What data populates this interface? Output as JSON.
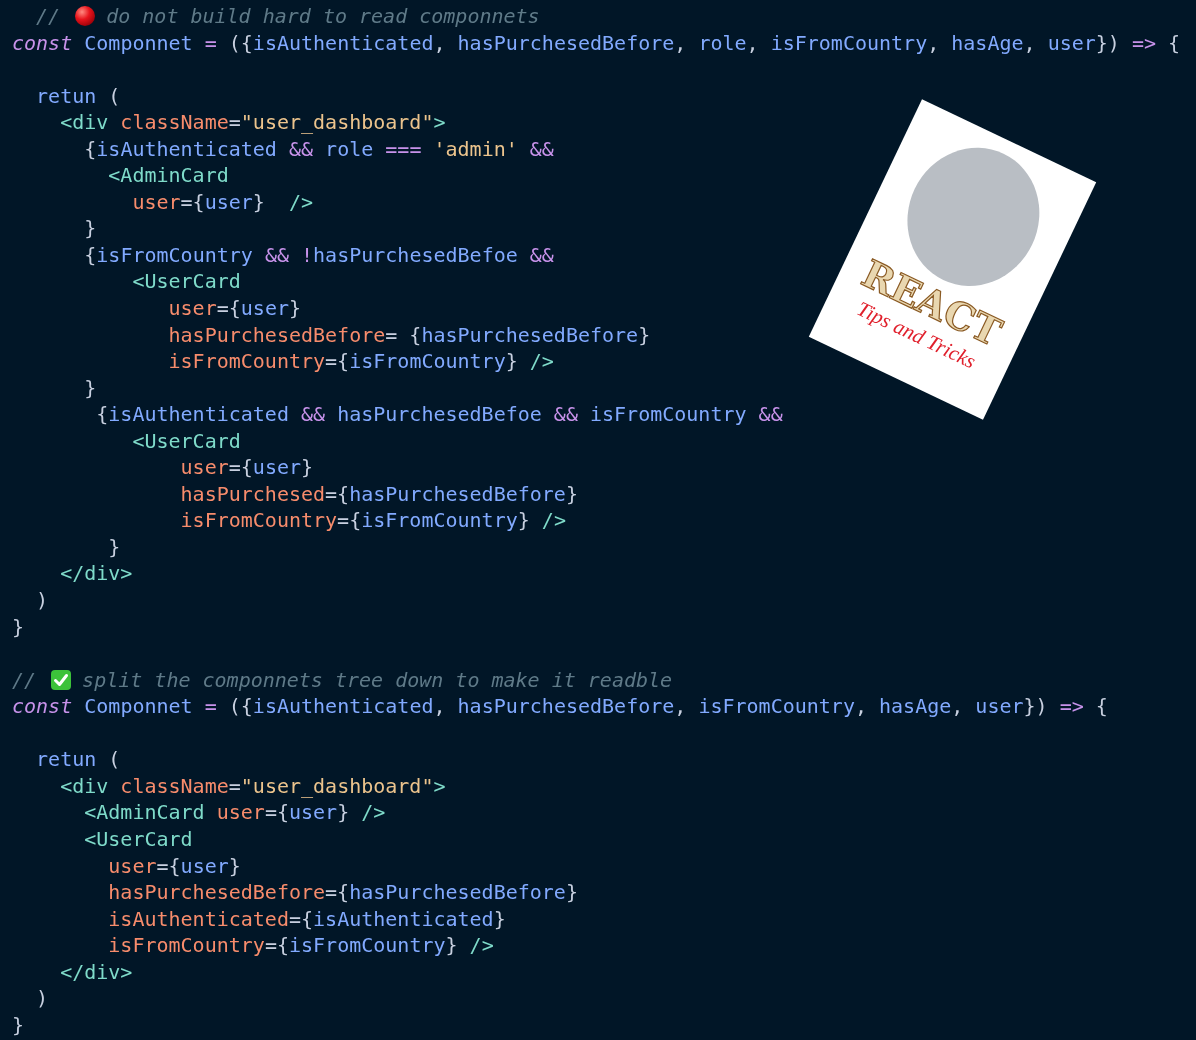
{
  "editor": {
    "lines": [
      {
        "kind": "warning_comment",
        "prefix": "  //",
        "text": "do not build hard to read componnets"
      },
      {
        "kind": "code",
        "tokens": [
          {
            "kind": "keyword",
            "text": "const"
          },
          {
            "kind": "variable",
            "text": " Componnet"
          },
          {
            "kind": "operator",
            "text": " = "
          },
          {
            "kind": "punct",
            "text": "({"
          },
          {
            "kind": "variable",
            "text": "isAuthenticated"
          },
          {
            "kind": "punct",
            "text": ","
          },
          {
            "kind": "variable",
            "text": " hasPurchesedBefore"
          },
          {
            "kind": "punct",
            "text": ","
          },
          {
            "kind": "variable",
            "text": " role"
          },
          {
            "kind": "punct",
            "text": ","
          },
          {
            "kind": "variable",
            "text": " isFromCountry"
          },
          {
            "kind": "punct",
            "text": ","
          },
          {
            "kind": "variable",
            "text": " hasAge"
          },
          {
            "kind": "punct",
            "text": ","
          },
          {
            "kind": "variable",
            "text": " user"
          },
          {
            "kind": "punct",
            "text": "})"
          },
          {
            "kind": "operator",
            "text": " => "
          },
          {
            "kind": "punct",
            "text": "{"
          }
        ]
      },
      {
        "kind": "blank"
      },
      {
        "kind": "code",
        "tokens": [
          {
            "kind": "variable",
            "text": "  retun"
          },
          {
            "kind": "punct",
            "text": " ("
          }
        ]
      },
      {
        "kind": "code",
        "tokens": [
          {
            "kind": "tag",
            "text": "    <div"
          },
          {
            "kind": "attr",
            "text": " className"
          },
          {
            "kind": "punct",
            "text": "="
          },
          {
            "kind": "string",
            "text": "\"user_dashboard\""
          },
          {
            "kind": "tag",
            "text": ">"
          }
        ]
      },
      {
        "kind": "code",
        "tokens": [
          {
            "kind": "punct",
            "text": "      {"
          },
          {
            "kind": "variable",
            "text": "isAuthenticated"
          },
          {
            "kind": "operator",
            "text": " && "
          },
          {
            "kind": "variable",
            "text": "role"
          },
          {
            "kind": "operator",
            "text": " === "
          },
          {
            "kind": "string",
            "text": "'admin'"
          },
          {
            "kind": "operator",
            "text": " &&"
          }
        ]
      },
      {
        "kind": "code",
        "tokens": [
          {
            "kind": "tag",
            "text": "        <AdminCard"
          }
        ]
      },
      {
        "kind": "code",
        "tokens": [
          {
            "kind": "attr",
            "text": "          user"
          },
          {
            "kind": "punct",
            "text": "={"
          },
          {
            "kind": "variable",
            "text": "user"
          },
          {
            "kind": "punct",
            "text": "}"
          },
          {
            "kind": "tag",
            "text": "  />"
          }
        ]
      },
      {
        "kind": "code",
        "tokens": [
          {
            "kind": "punct",
            "text": "      }"
          }
        ]
      },
      {
        "kind": "code",
        "tokens": [
          {
            "kind": "punct",
            "text": "      {"
          },
          {
            "kind": "variable",
            "text": "isFromCountry"
          },
          {
            "kind": "operator",
            "text": " && !"
          },
          {
            "kind": "variable",
            "text": "hasPurchesedBefoe"
          },
          {
            "kind": "operator",
            "text": " &&"
          }
        ]
      },
      {
        "kind": "code",
        "tokens": [
          {
            "kind": "tag",
            "text": "          <UserCard"
          }
        ]
      },
      {
        "kind": "code",
        "tokens": [
          {
            "kind": "attr",
            "text": "             user"
          },
          {
            "kind": "punct",
            "text": "={"
          },
          {
            "kind": "variable",
            "text": "user"
          },
          {
            "kind": "punct",
            "text": "}"
          }
        ]
      },
      {
        "kind": "code",
        "tokens": [
          {
            "kind": "attr",
            "text": "             hasPurchesedBefore"
          },
          {
            "kind": "punct",
            "text": "= {"
          },
          {
            "kind": "variable",
            "text": "hasPurchesedBefore"
          },
          {
            "kind": "punct",
            "text": "}"
          }
        ]
      },
      {
        "kind": "code",
        "tokens": [
          {
            "kind": "attr",
            "text": "             isFromCountry"
          },
          {
            "kind": "punct",
            "text": "={"
          },
          {
            "kind": "variable",
            "text": "isFromCountry"
          },
          {
            "kind": "punct",
            "text": "}"
          },
          {
            "kind": "tag",
            "text": " />"
          }
        ]
      },
      {
        "kind": "code",
        "tokens": [
          {
            "kind": "punct",
            "text": "      }"
          }
        ]
      },
      {
        "kind": "code",
        "tokens": [
          {
            "kind": "punct",
            "text": "       {"
          },
          {
            "kind": "variable",
            "text": "isAuthenticated"
          },
          {
            "kind": "operator",
            "text": " && "
          },
          {
            "kind": "variable",
            "text": "hasPurchesedBefoe"
          },
          {
            "kind": "operator",
            "text": " && "
          },
          {
            "kind": "variable",
            "text": "isFromCountry"
          },
          {
            "kind": "operator",
            "text": " &&"
          }
        ]
      },
      {
        "kind": "code",
        "tokens": [
          {
            "kind": "tag",
            "text": "          <UserCard"
          }
        ]
      },
      {
        "kind": "code",
        "tokens": [
          {
            "kind": "attr",
            "text": "              user"
          },
          {
            "kind": "punct",
            "text": "={"
          },
          {
            "kind": "variable",
            "text": "user"
          },
          {
            "kind": "punct",
            "text": "}"
          }
        ]
      },
      {
        "kind": "code",
        "tokens": [
          {
            "kind": "attr",
            "text": "              hasPurchesed"
          },
          {
            "kind": "punct",
            "text": "={"
          },
          {
            "kind": "variable",
            "text": "hasPurchesedBefore"
          },
          {
            "kind": "punct",
            "text": "}"
          }
        ]
      },
      {
        "kind": "code",
        "tokens": [
          {
            "kind": "attr",
            "text": "              isFromCountry"
          },
          {
            "kind": "punct",
            "text": "={"
          },
          {
            "kind": "variable",
            "text": "isFromCountry"
          },
          {
            "kind": "punct",
            "text": "}"
          },
          {
            "kind": "tag",
            "text": " />"
          }
        ]
      },
      {
        "kind": "code",
        "tokens": [
          {
            "kind": "punct",
            "text": "        }"
          }
        ]
      },
      {
        "kind": "code",
        "tokens": [
          {
            "kind": "tag",
            "text": "    </div>"
          }
        ]
      },
      {
        "kind": "code",
        "tokens": [
          {
            "kind": "punct",
            "text": "  )"
          }
        ]
      },
      {
        "kind": "code",
        "tokens": [
          {
            "kind": "punct",
            "text": "}"
          }
        ]
      },
      {
        "kind": "blank"
      },
      {
        "kind": "tip_comment",
        "prefix": "//",
        "text": "split the componnets tree down to make it readble"
      },
      {
        "kind": "code",
        "tokens": [
          {
            "kind": "keyword",
            "text": "const"
          },
          {
            "kind": "variable",
            "text": " Componnet"
          },
          {
            "kind": "operator",
            "text": " = "
          },
          {
            "kind": "punct",
            "text": "({"
          },
          {
            "kind": "variable",
            "text": "isAuthenticated"
          },
          {
            "kind": "punct",
            "text": ","
          },
          {
            "kind": "variable",
            "text": " hasPurchesedBefore"
          },
          {
            "kind": "punct",
            "text": ","
          },
          {
            "kind": "variable",
            "text": " isFromCountry"
          },
          {
            "kind": "punct",
            "text": ","
          },
          {
            "kind": "variable",
            "text": " hasAge"
          },
          {
            "kind": "punct",
            "text": ","
          },
          {
            "kind": "variable",
            "text": " user"
          },
          {
            "kind": "punct",
            "text": "})"
          },
          {
            "kind": "operator",
            "text": " => "
          },
          {
            "kind": "punct",
            "text": "{"
          }
        ]
      },
      {
        "kind": "blank"
      },
      {
        "kind": "code",
        "tokens": [
          {
            "kind": "variable",
            "text": "  retun"
          },
          {
            "kind": "punct",
            "text": " ("
          }
        ]
      },
      {
        "kind": "code",
        "tokens": [
          {
            "kind": "tag",
            "text": "    <div"
          },
          {
            "kind": "attr",
            "text": " className"
          },
          {
            "kind": "punct",
            "text": "="
          },
          {
            "kind": "string",
            "text": "\"user_dashboard\""
          },
          {
            "kind": "tag",
            "text": ">"
          }
        ]
      },
      {
        "kind": "code",
        "tokens": [
          {
            "kind": "tag",
            "text": "      <AdminCard"
          },
          {
            "kind": "attr",
            "text": " user"
          },
          {
            "kind": "punct",
            "text": "={"
          },
          {
            "kind": "variable",
            "text": "user"
          },
          {
            "kind": "punct",
            "text": "}"
          },
          {
            "kind": "tag",
            "text": " />"
          }
        ]
      },
      {
        "kind": "code",
        "tokens": [
          {
            "kind": "tag",
            "text": "      <UserCard"
          }
        ]
      },
      {
        "kind": "code",
        "tokens": [
          {
            "kind": "attr",
            "text": "        user"
          },
          {
            "kind": "punct",
            "text": "={"
          },
          {
            "kind": "variable",
            "text": "user"
          },
          {
            "kind": "punct",
            "text": "}"
          }
        ]
      },
      {
        "kind": "code",
        "tokens": [
          {
            "kind": "attr",
            "text": "        hasPurchesedBefore"
          },
          {
            "kind": "punct",
            "text": "={"
          },
          {
            "kind": "variable",
            "text": "hasPurchesedBefore"
          },
          {
            "kind": "punct",
            "text": "}"
          }
        ]
      },
      {
        "kind": "code",
        "tokens": [
          {
            "kind": "attr",
            "text": "        isAuthenticated"
          },
          {
            "kind": "punct",
            "text": "={"
          },
          {
            "kind": "variable",
            "text": "isAuthenticated"
          },
          {
            "kind": "punct",
            "text": "}"
          }
        ]
      },
      {
        "kind": "code",
        "tokens": [
          {
            "kind": "attr",
            "text": "        isFromCountry"
          },
          {
            "kind": "punct",
            "text": "={"
          },
          {
            "kind": "variable",
            "text": "isFromCountry"
          },
          {
            "kind": "punct",
            "text": "}"
          },
          {
            "kind": "tag",
            "text": " />"
          }
        ]
      },
      {
        "kind": "code",
        "tokens": [
          {
            "kind": "tag",
            "text": "    </div>"
          }
        ]
      },
      {
        "kind": "code",
        "tokens": [
          {
            "kind": "punct",
            "text": "  )"
          }
        ]
      },
      {
        "kind": "code",
        "tokens": [
          {
            "kind": "punct",
            "text": "}"
          }
        ]
      }
    ]
  },
  "sticker": {
    "title": "REACT",
    "subtitle": "Tips and Tricks"
  }
}
